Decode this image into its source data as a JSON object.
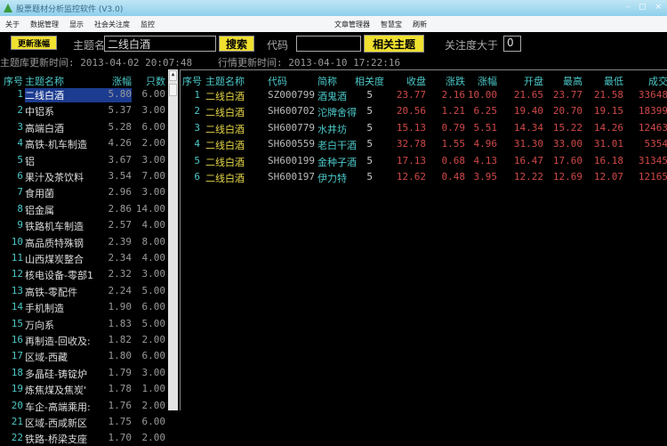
{
  "window": {
    "title": "股票题材分析监控软件 (V3.0)"
  },
  "menu": {
    "left": [
      "关于",
      "数据管理",
      "显示",
      "社会关注度",
      "监控"
    ],
    "right": [
      "文章管理器",
      "智慧宝",
      "刷新"
    ]
  },
  "toolbar": {
    "update_btn": "更新涨幅",
    "theme_label": "主题名",
    "theme_value": "二线白酒",
    "search_btn": "搜索",
    "code_label": "代码",
    "code_value": "",
    "related_btn": "相关主题",
    "attention_label": "关注度大于",
    "attention_value": "0"
  },
  "times": {
    "theme_db": "主题库更新时间: 2013-04-02 20:07:48",
    "quote": "行情更新时间: 2013-04-10 17:22:16"
  },
  "left": {
    "headers": [
      "序号",
      "主题名称",
      "涨幅",
      "只数"
    ],
    "rows": [
      [
        "1",
        "二线白酒",
        "5.80",
        "6.00"
      ],
      [
        "2",
        "中铝系",
        "5.37",
        "3.00"
      ],
      [
        "3",
        "高端白酒",
        "5.28",
        "6.00"
      ],
      [
        "4",
        "高铁-机车制造",
        "4.26",
        "2.00"
      ],
      [
        "5",
        "铝",
        "3.67",
        "3.00"
      ],
      [
        "6",
        "果汁及茶饮料",
        "3.54",
        "7.00"
      ],
      [
        "7",
        "食用菌",
        "2.96",
        "3.00"
      ],
      [
        "8",
        "铝金属",
        "2.86",
        "14.00"
      ],
      [
        "9",
        "铁路机车制造",
        "2.57",
        "4.00"
      ],
      [
        "10",
        "高品质特殊钢",
        "2.39",
        "8.00"
      ],
      [
        "11",
        "山西煤炭整合",
        "2.34",
        "4.00"
      ],
      [
        "12",
        "核电设备-零部1",
        "2.32",
        "3.00"
      ],
      [
        "13",
        "高铁-零配件",
        "2.24",
        "5.00"
      ],
      [
        "14",
        "手机制造",
        "1.90",
        "6.00"
      ],
      [
        "15",
        "万向系",
        "1.83",
        "5.00"
      ],
      [
        "16",
        "再制造-回收及:",
        "1.82",
        "2.00"
      ],
      [
        "17",
        "区域-西藏",
        "1.80",
        "6.00"
      ],
      [
        "18",
        "多晶硅-铸锭炉",
        "1.79",
        "3.00"
      ],
      [
        "19",
        "炼焦煤及焦炭'",
        "1.78",
        "1.00"
      ],
      [
        "20",
        "车企-高端乘用:",
        "1.76",
        "2.00"
      ],
      [
        "21",
        "区域-西咸新区",
        "1.75",
        "6.00"
      ],
      [
        "22",
        "铁路-桥梁支座",
        "1.70",
        "2.00"
      ]
    ]
  },
  "right": {
    "headers": [
      "序号",
      "主题名称",
      "代码",
      "简称",
      "相关度",
      "收盘",
      "涨跌",
      "涨幅",
      "开盘",
      "最高",
      "最低",
      "成交"
    ],
    "rows": [
      [
        "1",
        "二线白酒",
        "SZ000799",
        "酒鬼酒",
        "5",
        "23.77",
        "2.16",
        "10.00",
        "21.65",
        "23.77",
        "21.58",
        "33648"
      ],
      [
        "2",
        "二线白酒",
        "SH600702",
        "沱牌舍得",
        "5",
        "20.56",
        "1.21",
        "6.25",
        "19.40",
        "20.70",
        "19.15",
        "18399"
      ],
      [
        "3",
        "二线白酒",
        "SH600779",
        "水井坊",
        "5",
        "15.13",
        "0.79",
        "5.51",
        "14.34",
        "15.22",
        "14.26",
        "12463"
      ],
      [
        "4",
        "二线白酒",
        "SH600559",
        "老白干酒",
        "5",
        "32.78",
        "1.55",
        "4.96",
        "31.30",
        "33.00",
        "31.01",
        "5354"
      ],
      [
        "5",
        "二线白酒",
        "SH600199",
        "金种子酒",
        "5",
        "17.13",
        "0.68",
        "4.13",
        "16.47",
        "17.60",
        "16.18",
        "31345"
      ],
      [
        "6",
        "二线白酒",
        "SH600197",
        "伊力特",
        "5",
        "12.62",
        "0.48",
        "3.95",
        "12.22",
        "12.69",
        "12.07",
        "12165"
      ]
    ]
  }
}
